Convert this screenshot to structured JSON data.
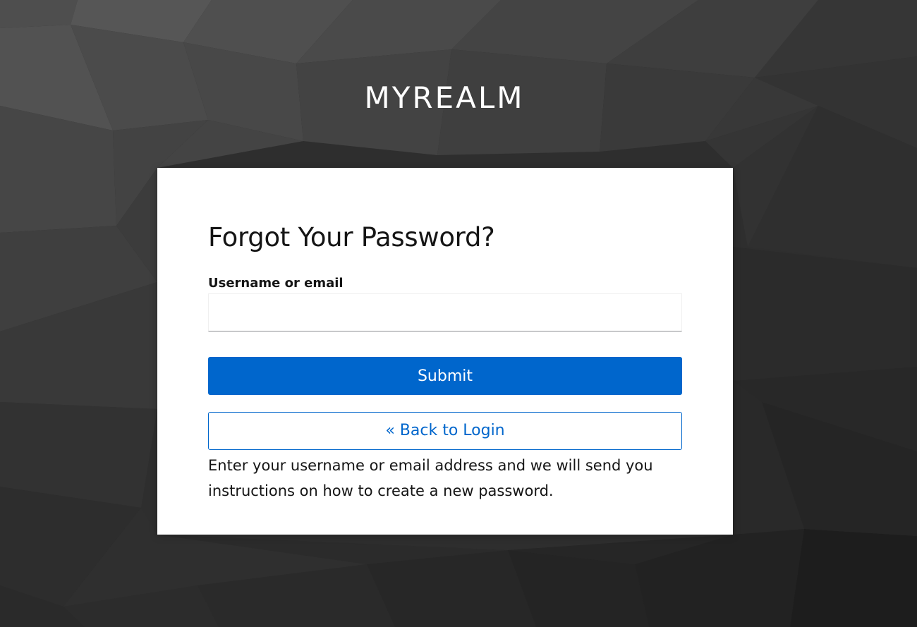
{
  "realm": {
    "title": "MYREALM"
  },
  "form": {
    "heading": "Forgot Your Password?",
    "username_label": "Username or email",
    "username_value": "",
    "submit_label": "Submit",
    "back_label": "« Back to Login",
    "info_text": "Enter your username or email address and we will send you instructions on how to create a new password."
  },
  "colors": {
    "primary": "#0066cc",
    "background_dark": "#2f2f2f",
    "card": "#ffffff",
    "text": "#151515"
  }
}
